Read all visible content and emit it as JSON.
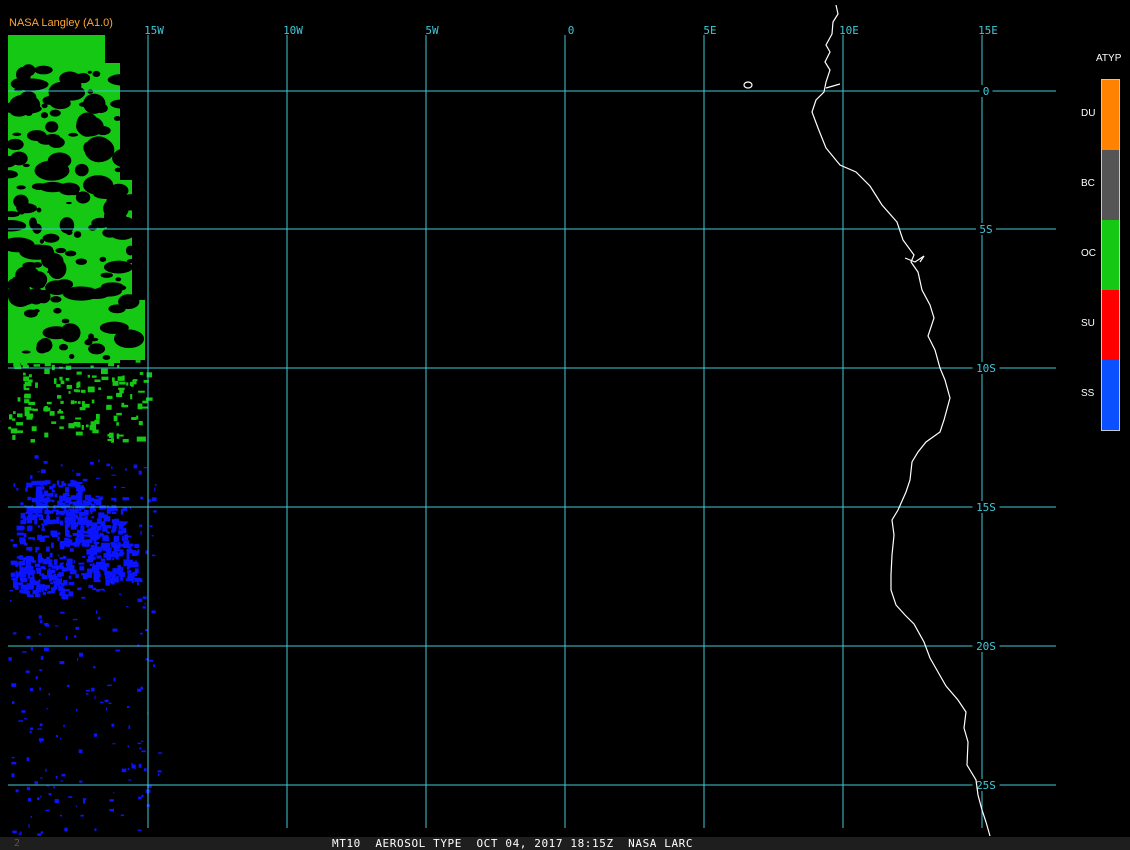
{
  "credit": "NASA Langley (A1.0)",
  "footer": {
    "caption": "MT10  AEROSOL TYPE  OCT 04, 2017 18:15Z  NASA LARC",
    "frame_number": "2"
  },
  "map": {
    "grid_color": "#3fc8d8",
    "coastline_color": "#ffffff",
    "longitude_labels": [
      "15W",
      "10W",
      "5W",
      "0",
      "5E",
      "10E",
      "15E"
    ],
    "latitude_labels": [
      "0",
      "5S",
      "10S",
      "15S",
      "20S",
      "25S"
    ]
  },
  "legend": {
    "title": "ATYP",
    "classes": [
      {
        "label": "DU",
        "color": "#ff8200"
      },
      {
        "label": "BC",
        "color": "#555555"
      },
      {
        "label": "OC",
        "color": "#14c814"
      },
      {
        "label": "SU",
        "color": "#ff0000"
      },
      {
        "label": "SS",
        "color": "#0a50ff"
      }
    ]
  },
  "data_swath": {
    "oc_color": "#14c814",
    "ss_color": "#0a14ff"
  }
}
